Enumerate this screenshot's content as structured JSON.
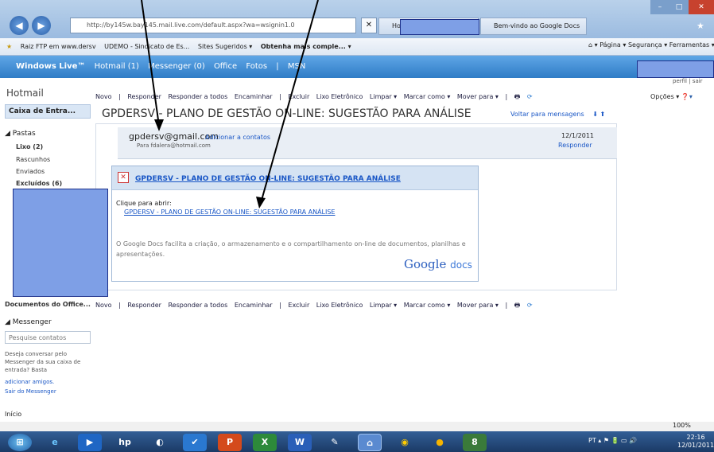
{
  "browser": {
    "address": "http://by145w.bay145.mail.live.com/default.aspx?wa=wsignin1.0",
    "tab_hotmail": "Hotma",
    "tab_docs": "Bem-vindo ao Google Docs",
    "favorites": [
      "Raiz FTP em www.dersv",
      "UDEMO - Sindicato de Es...",
      "Sites Sugeridos ▾",
      "Obtenha mais comple... ▾"
    ],
    "tools": [
      "Página ▾",
      "Segurança ▾",
      "Ferramentas ▾"
    ]
  },
  "windows_live": {
    "brand": "Windows Live™",
    "links": [
      "Hotmail (1)",
      "Messenger (0)",
      "Office",
      "Fotos",
      "|",
      "MSN"
    ],
    "profile": "perfil | sair"
  },
  "sidebar": {
    "app_title": "Hotmail",
    "inbox": "Caixa de Entra...",
    "folders_header": "◢ Pastas",
    "folders": [
      "Lixo (2)",
      "Rascunhos",
      "Enviados",
      "Excluídos (6)"
    ],
    "office_docs": "Documentos do Office...",
    "messenger_header": "◢ Messenger",
    "search_placeholder": "Pesquise contatos",
    "messenger_text": "Deseja conversar pelo Messenger da sua caixa de entrada? Basta",
    "add_friends": "adicionar amigos.",
    "sign_out": "Sair do Messenger",
    "start": "Início"
  },
  "toolbar": {
    "items": [
      "Novo",
      "|",
      "Responder",
      "Responder a todos",
      "Encaminhar",
      "|",
      "Excluir",
      "Lixo Eletrônico",
      "Limpar ▾",
      "Marcar como ▾",
      "Mover para ▾",
      "|"
    ],
    "options": "Opções ▾"
  },
  "message": {
    "subject": "GPDERSV - PLANO DE GESTÃO ON-LINE: SUGESTÃO PARA ANÁLISE",
    "back_to_messages": "Voltar para mensagens",
    "from": "gpdersv@gmail.com",
    "add_contact": "Adicionar a contatos",
    "to": "Para fdalera@hotmail.com",
    "date": "12/1/2011",
    "reply": "Responder",
    "card_title": "GPDERSV - PLANO DE GESTÃO ON-LINE: SUGESTÃO PARA ANÁLISE",
    "click_to_open": "Clique para abrir:",
    "doc_link": "GPDERSV - PLANO DE GESTÃO ON-LINE: SUGESTÃO PARA ANÁLISE",
    "description": "O Google Docs facilita a criação, o armazenamento e o compartilhamento on-line de documentos, planilhas e apresentações.",
    "logo_google": "Google",
    "logo_docs": "docs"
  },
  "status": {
    "zoom": "100%",
    "lang": "PT",
    "time": "22:16",
    "date": "12/01/2011"
  },
  "colors": {
    "accent_blue": "#1a57c6",
    "live_bar": "#2f7cc6",
    "taskbar": "#1b3a66"
  }
}
